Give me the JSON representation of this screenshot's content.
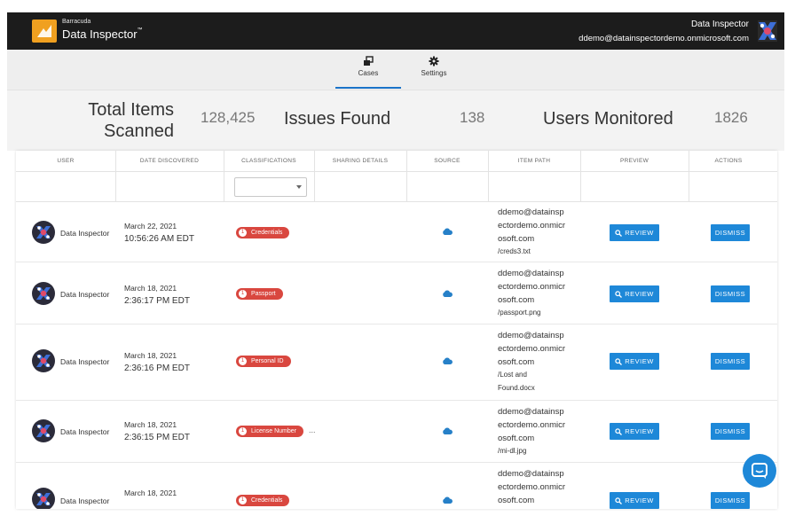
{
  "header": {
    "brand_small": "Barracuda",
    "brand_name": "Data Inspector",
    "brand_tm": "™",
    "user_name": "Data Inspector",
    "user_email": "ddemo@datainspectordemo.onmicrosoft.com",
    "logo_icon": "barracuda-logo-icon",
    "avatar_icon": "user-avatar-icon"
  },
  "nav": {
    "tabs": [
      {
        "label": "Cases",
        "icon": "cases-icon",
        "active": true
      },
      {
        "label": "Settings",
        "icon": "gear-icon",
        "active": false
      }
    ]
  },
  "stats": {
    "total_label_1": "Total Items",
    "total_label_2": "Scanned",
    "total_value": "128,425",
    "issues_label": "Issues Found",
    "issues_value": "138",
    "users_label": "Users Monitored",
    "users_value": "1826"
  },
  "table": {
    "headers": [
      "USER",
      "DATE DISCOVERED",
      "CLASSIFICATIONS",
      "SHARING DETAILS",
      "SOURCE",
      "ITEM PATH",
      "PREVIEW",
      "ACTIONS"
    ],
    "review_label": "REVIEW",
    "dismiss_label": "DISMISS",
    "rows": [
      {
        "user": "Data Inspector",
        "date": "March 22, 2021",
        "time": "10:56:26 AM EDT",
        "count": "1",
        "classification": "Credentials",
        "more": "",
        "path": [
          "ddemo@datainsp",
          "ectordemo.onmicr",
          "osoft.com"
        ],
        "file": [
          "/creds3.txt"
        ]
      },
      {
        "user": "Data Inspector",
        "date": "March 18, 2021",
        "time": "2:36:17 PM EDT",
        "count": "1",
        "classification": "Passport",
        "more": "",
        "path": [
          "ddemo@datainsp",
          "ectordemo.onmicr",
          "osoft.com"
        ],
        "file": [
          "/passport.png"
        ]
      },
      {
        "user": "Data Inspector",
        "date": "March 18, 2021",
        "time": "2:36:16 PM EDT",
        "count": "1",
        "classification": "Personal ID",
        "more": "",
        "path": [
          "ddemo@datainsp",
          "ectordemo.onmicr",
          "osoft.com"
        ],
        "file": [
          "/Lost and",
          "Found.docx"
        ]
      },
      {
        "user": "Data Inspector",
        "date": "March 18, 2021",
        "time": "2:36:15 PM EDT",
        "count": "1",
        "classification": "License Number",
        "more": "...",
        "path": [
          "ddemo@datainsp",
          "ectordemo.onmicr",
          "osoft.com"
        ],
        "file": [
          "/mi-dl.jpg"
        ]
      },
      {
        "user": "Data Inspector",
        "date": "March 18, 2021",
        "time": "",
        "count": "1",
        "classification": "Credentials",
        "more": "",
        "path": [
          "ddemo@datainsp",
          "ectordemo.onmicr",
          "osoft.com"
        ],
        "file": []
      }
    ]
  },
  "colors": {
    "topbar": "#1c1c1c",
    "logo": "#f0a020",
    "accent": "#1e88d8",
    "pill": "#d9473f"
  },
  "chat_icon": "chat-bubble-icon"
}
